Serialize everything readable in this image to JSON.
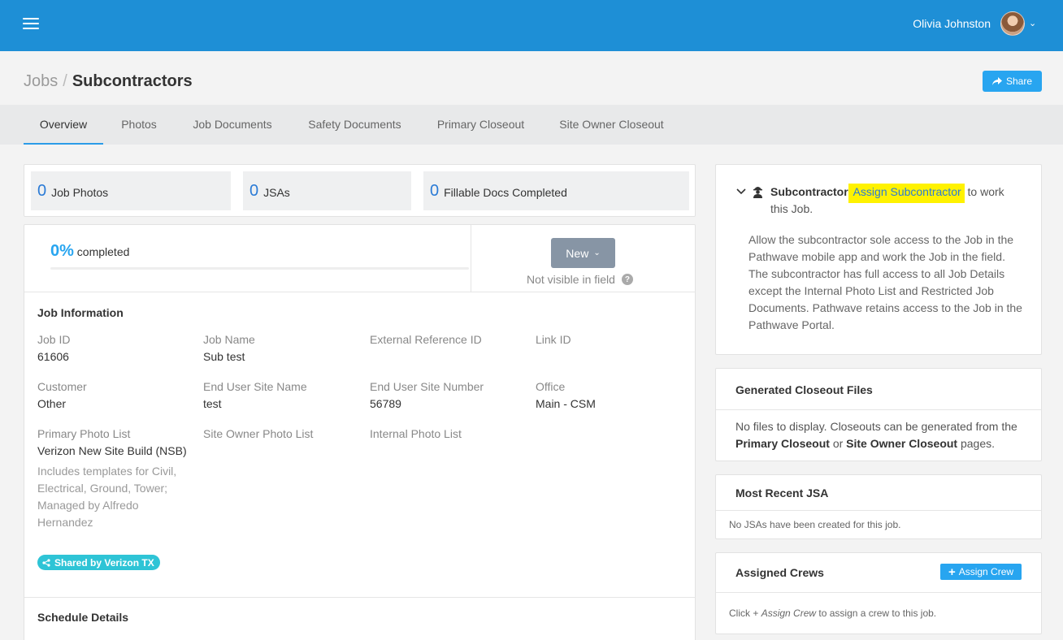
{
  "header": {
    "user_name": "Olivia Johnston"
  },
  "breadcrumb": {
    "parent": "Jobs",
    "separator": "/",
    "current": "Subcontractors"
  },
  "share_label": "Share",
  "tabs": [
    "Overview",
    "Photos",
    "Job Documents",
    "Safety Documents",
    "Primary Closeout",
    "Site Owner Closeout"
  ],
  "stats": [
    {
      "value": "0",
      "label": "Job Photos"
    },
    {
      "value": "0",
      "label": "JSAs"
    },
    {
      "value": "0",
      "label": "Fillable Docs Completed"
    }
  ],
  "progress": {
    "value": "0%",
    "label": "completed",
    "fraction": 0
  },
  "status": {
    "button": "New",
    "note": "Not visible in field"
  },
  "job_info": {
    "title": "Job Information",
    "job_id_label": "Job ID",
    "job_id": "61606",
    "job_name_label": "Job Name",
    "job_name": "Sub test",
    "ext_ref_label": "External Reference ID",
    "link_id_label": "Link ID",
    "customer_label": "Customer",
    "customer": "Other",
    "site_name_label": "End User Site Name",
    "site_name": "test",
    "site_number_label": "End User Site Number",
    "site_number": "56789",
    "office_label": "Office",
    "office": "Main - CSM",
    "primary_photo_label": "Primary Photo List",
    "primary_photo": "Verizon New Site Build (NSB)",
    "primary_photo_desc": "Includes templates for Civil, Electrical, Ground, Tower; Managed by Alfredo Hernandez",
    "site_owner_photo_label": "Site Owner Photo List",
    "internal_photo_label": "Internal Photo List",
    "shared_badge": "Shared by Verizon TX"
  },
  "schedule_title": "Schedule Details",
  "subcontractor": {
    "label": "Subcontractor",
    "link": "Assign Subcontractor",
    "suffix_1": "to work",
    "suffix_2": "this Job.",
    "description": "Allow the subcontractor sole access to the Job in the Pathwave mobile app and work the Job in the field. The subcontractor has full access to all Job Details except the Internal Photo List and Restricted Job Documents. Pathwave retains access to the Job in the Pathwave Portal."
  },
  "closeout_files": {
    "title": "Generated Closeout Files",
    "text_1": "No files to display. Closeouts can be generated from the",
    "link_1": "Primary Closeout",
    "text_2": "or",
    "link_2": "Site Owner Closeout",
    "text_3": "pages."
  },
  "recent_jsa": {
    "title": "Most Recent JSA",
    "empty": "No JSAs have been created for this job."
  },
  "crews": {
    "title": "Assigned Crews",
    "button": "Assign Crew",
    "hint_1": "Click +",
    "hint_link": "Assign Crew",
    "hint_2": "to assign a crew to this job."
  }
}
